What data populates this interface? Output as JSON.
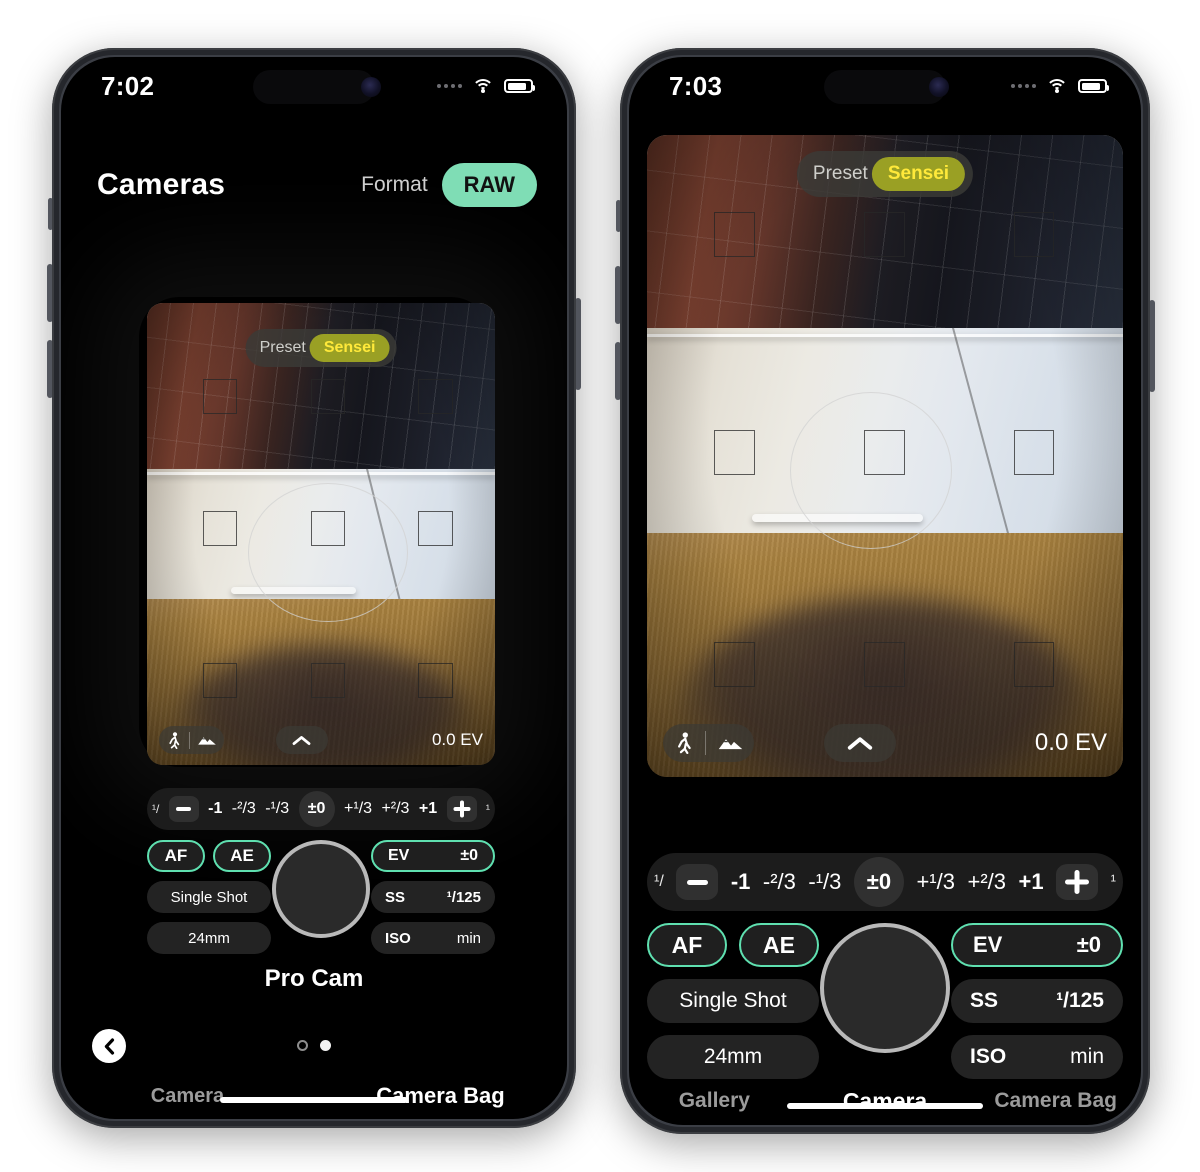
{
  "meta": {
    "accent_teal": "#5fe0b0",
    "raw_pill_bg": "#7fddb5",
    "preset_bg": "#9aa024",
    "preset_fg": "#ffe93a",
    "panel_bg": "#1c1c1c",
    "pill_bg": "#232323"
  },
  "left_phone": {
    "status_bar": {
      "time": "7:02",
      "wifi_icon": "wifi-icon",
      "battery_icon": "battery-icon",
      "cellular_icon": "cellular-dots-icon"
    },
    "header": {
      "title": "Cameras",
      "format_label": "Format",
      "format_value": "RAW"
    },
    "viewfinder": {
      "preset_label": "Preset",
      "preset_value": "Sensei",
      "mode_person_icon": "person-walking-icon",
      "mode_landscape_icon": "landscape-icon",
      "expand_icon": "chevron-up-icon",
      "ev_readout": "0.0 EV"
    },
    "ev_scale": {
      "minus_icon": "minus-icon",
      "plus_icon": "plus-icon",
      "edge_left": "¹/",
      "edge_right": "¹",
      "ticks": [
        "-1",
        "-²/3",
        "-¹/3",
        "±0",
        "+¹/3",
        "+²/3",
        "+1"
      ],
      "selected": "±0"
    },
    "controls": {
      "af_label": "AF",
      "ae_label": "AE",
      "drive_label": "Single Shot",
      "lens_label": "24mm",
      "shutter_button": "shutter-button",
      "ev": {
        "key": "EV",
        "value": "±0"
      },
      "ss": {
        "key": "SS",
        "value": "¹/125"
      },
      "iso": {
        "key": "ISO",
        "value": "min"
      }
    },
    "camera_name": "Pro Cam",
    "pager": {
      "count": 2,
      "active_index": 1
    },
    "back_icon": "chevron-left-icon",
    "tabs": [
      {
        "label": "Camera",
        "active": false
      },
      {
        "label": "Camera Bag",
        "active": true
      }
    ]
  },
  "right_phone": {
    "status_bar": {
      "time": "7:03",
      "wifi_icon": "wifi-icon",
      "battery_icon": "battery-icon",
      "cellular_icon": "cellular-dots-icon"
    },
    "viewfinder": {
      "preset_label": "Preset",
      "preset_value": "Sensei",
      "mode_person_icon": "person-walking-icon",
      "mode_landscape_icon": "landscape-icon",
      "expand_icon": "chevron-up-icon",
      "ev_readout": "0.0 EV"
    },
    "ev_scale": {
      "minus_icon": "minus-icon",
      "plus_icon": "plus-icon",
      "edge_left": "¹/",
      "edge_right": "¹",
      "ticks": [
        "-1",
        "-²/3",
        "-¹/3",
        "±0",
        "+¹/3",
        "+²/3",
        "+1"
      ],
      "selected": "±0"
    },
    "controls": {
      "af_label": "AF",
      "ae_label": "AE",
      "drive_label": "Single Shot",
      "lens_label": "24mm",
      "shutter_button": "shutter-button",
      "ev": {
        "key": "EV",
        "value": "±0"
      },
      "ss": {
        "key": "SS",
        "value": "¹/125"
      },
      "iso": {
        "key": "ISO",
        "value": "min"
      }
    },
    "tabs": [
      {
        "label": "Gallery",
        "active": false
      },
      {
        "label": "Camera",
        "active": true
      },
      {
        "label": "Camera Bag",
        "active": false
      }
    ]
  }
}
